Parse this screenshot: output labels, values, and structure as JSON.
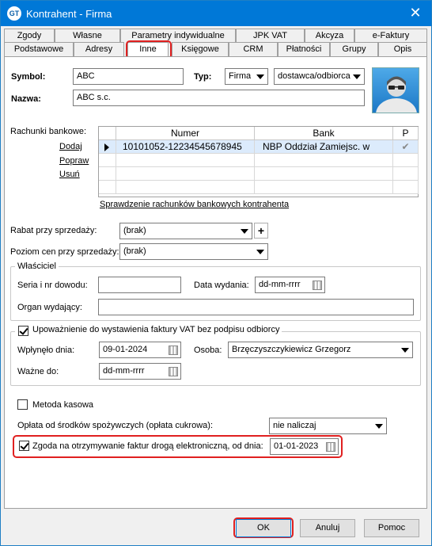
{
  "window": {
    "title": "Kontrahent - Firma",
    "app_icon_text": "GT",
    "close_glyph": "✕"
  },
  "tabs_row1": [
    "Zgody",
    "Własne",
    "Parametry indywidualne",
    "JPK VAT",
    "Akcyza",
    "e-Faktury"
  ],
  "tabs_row2": [
    "Podstawowe",
    "Adresy",
    "Inne",
    "Księgowe",
    "CRM",
    "Płatności",
    "Grupy",
    "Opis"
  ],
  "active_tab": "Inne",
  "header": {
    "symbol_label": "Symbol:",
    "symbol_value": "ABC",
    "typ_label": "Typ:",
    "typ_value": "Firma",
    "typ2_value": "dostawca/odbiorca",
    "nazwa_label": "Nazwa:",
    "nazwa_value": "ABC s.c."
  },
  "bank": {
    "label": "Rachunki bankowe:",
    "actions": [
      "Dodaj",
      "Popraw",
      "Usuń"
    ],
    "columns": [
      "Numer",
      "Bank",
      "P"
    ],
    "rows": [
      {
        "numer": "10101052-12234545678945",
        "bank": "NBP Oddział Zamiejsc. w",
        "p": "✔"
      }
    ],
    "check_link": "Sprawdzenie rachunków bankowych kontrahenta"
  },
  "rabat": {
    "label": "Rabat przy sprzedaży:",
    "value": "(brak)",
    "plus": "+"
  },
  "poziom": {
    "label": "Poziom cen przy sprzedaży:",
    "value": "(brak)"
  },
  "wlasciciel": {
    "title": "Właściciel",
    "seria_label": "Seria i nr dowodu:",
    "seria_value": "",
    "data_label": "Data wydania:",
    "data_value": "dd-mm-rrrr",
    "organ_label": "Organ wydający:",
    "organ_value": ""
  },
  "upowaznienie": {
    "title": "Upoważnienie do wystawienia faktury VAT bez podpisu odbiorcy",
    "checked": true,
    "wplynelo_label": "Wpłynęło dnia:",
    "wplynelo_value": "09-01-2024",
    "osoba_label": "Osoba:",
    "osoba_value": "Brzęczyszczykiewicz Grzegorz",
    "wazne_label": "Ważne do:",
    "wazne_value": "dd-mm-rrrr"
  },
  "metoda_kasowa": {
    "label": "Metoda kasowa",
    "checked": false
  },
  "oplata": {
    "label": "Opłata od środków spożywczych (opłata cukrowa):",
    "value": "nie naliczaj"
  },
  "zgoda": {
    "label": "Zgoda na otrzymywanie faktur drogą elektroniczną, od dnia:",
    "checked": true,
    "date": "01-01-2023"
  },
  "buttons": {
    "ok": "OK",
    "anuluj": "Anuluj",
    "pomoc": "Pomoc"
  },
  "colors": {
    "title_bar": "#0078d7",
    "highlight": "#e02020",
    "row_selected": "#dcebfc"
  }
}
